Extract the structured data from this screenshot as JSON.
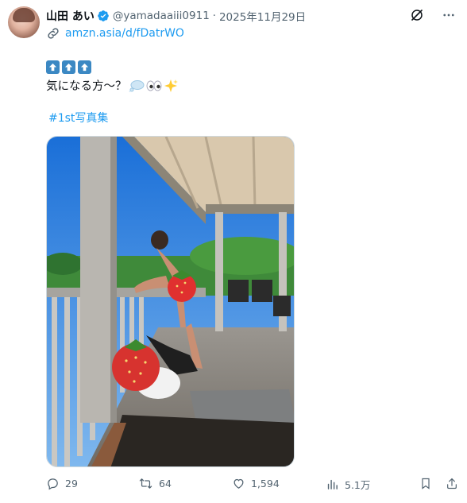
{
  "post": {
    "author_name": "山田 あい",
    "handle": "@yamadaaiii0911",
    "separator": "·",
    "date": "2025年11月29日",
    "link_text": "amzn.asia/d/fDatrWO",
    "body_text": "気になる方～？",
    "hashtag": "#1st写真集"
  },
  "icons": {
    "verified": "verified-badge-icon",
    "grok": "grok-icon",
    "more": "more-icon",
    "link": "link-icon",
    "up_arrow": "up-arrow-emoji",
    "thought": "thought-bubble-emoji",
    "eyes": "eyes-emoji",
    "sparkles": "sparkles-emoji"
  },
  "actions": {
    "replies": "29",
    "reposts": "64",
    "likes": "1,594",
    "views": "5.1万"
  },
  "colors": {
    "link": "#1d9bf0",
    "verified": "#1d9bf0",
    "muted": "#536471",
    "text": "#0f1419",
    "arrow_emoji": "#3b88c3"
  }
}
